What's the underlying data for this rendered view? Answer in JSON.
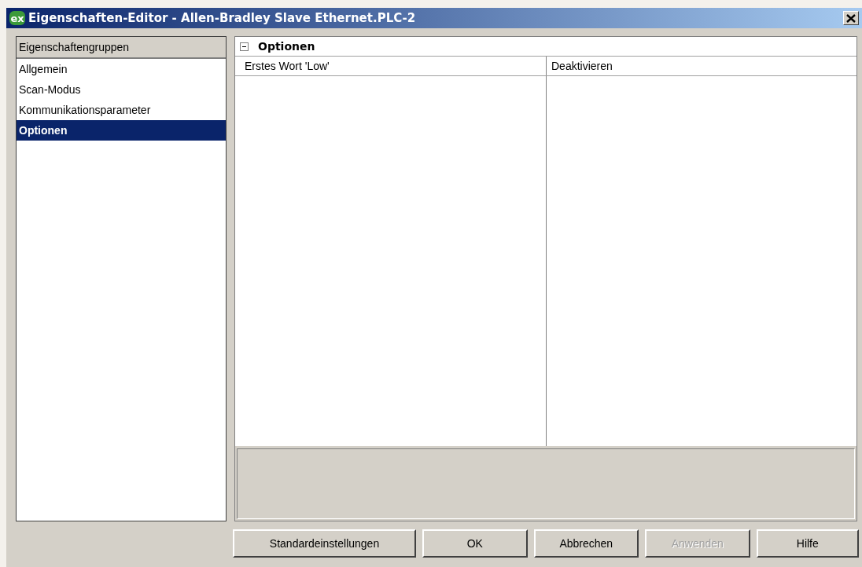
{
  "window": {
    "title": "Eigenschaften-Editor - Allen-Bradley Slave Ethernet.PLC-2",
    "logo_text": "ex"
  },
  "groups": {
    "header": "Eigenschaftengruppen",
    "items": [
      {
        "label": "Allgemein",
        "selected": false
      },
      {
        "label": "Scan-Modus",
        "selected": false
      },
      {
        "label": "Kommunikationsparameter",
        "selected": false
      },
      {
        "label": "Optionen",
        "selected": true
      }
    ]
  },
  "properties": {
    "section": {
      "title": "Optionen",
      "expanded": true
    },
    "rows": [
      {
        "name": "Erstes Wort 'Low'",
        "value": "Deaktivieren"
      }
    ]
  },
  "buttons": [
    {
      "label": "Standardeinstellungen",
      "disabled": false
    },
    {
      "label": "OK",
      "disabled": false
    },
    {
      "label": "Abbrechen",
      "disabled": false
    },
    {
      "label": "Anwenden",
      "disabled": true
    },
    {
      "label": "Hilfe",
      "disabled": false
    }
  ]
}
